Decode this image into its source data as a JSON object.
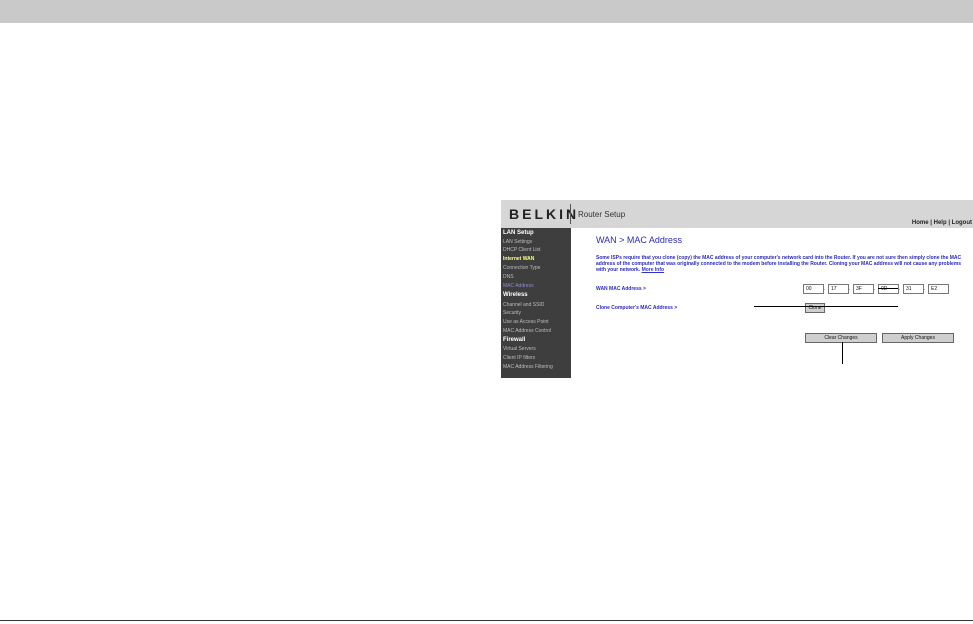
{
  "logo": "BELKIN",
  "app_title": "Router Setup",
  "header_links": [
    "Home",
    "Help",
    "Logout"
  ],
  "header_link_sep": "|",
  "sidebar": [
    {
      "label": "LAN Setup",
      "kind": "head"
    },
    {
      "label": "LAN Settings",
      "kind": "item"
    },
    {
      "label": "DHCP Client List",
      "kind": "item"
    },
    {
      "label": "Internet WAN",
      "kind": "active"
    },
    {
      "label": "Connection Type",
      "kind": "item"
    },
    {
      "label": "DNS",
      "kind": "item"
    },
    {
      "label": "MAC Address",
      "kind": "current"
    },
    {
      "label": "Wireless",
      "kind": "head"
    },
    {
      "label": "Channel and SSID",
      "kind": "item"
    },
    {
      "label": "Security",
      "kind": "item"
    },
    {
      "label": "Use as Access Point",
      "kind": "item"
    },
    {
      "label": "MAC Address Control",
      "kind": "item"
    },
    {
      "label": "Firewall",
      "kind": "head"
    },
    {
      "label": "Virtual Servers",
      "kind": "item"
    },
    {
      "label": "Client IP filters",
      "kind": "item"
    },
    {
      "label": "MAC Address Filtering",
      "kind": "item"
    }
  ],
  "main": {
    "title": "WAN > MAC Address",
    "description": "Some ISPs require that you clone (copy) the MAC address of your computer's network card into the Router. If you are not sure then simply clone the MAC address of the computer that was originally connected to the modem before installing the Router. Cloning your MAC address will not cause any problems with your network.",
    "more_info": "More Info",
    "wan_mac_label": "WAN MAC Address >",
    "mac_octets": [
      "00",
      "17",
      "3F",
      "0D",
      "31",
      "E2"
    ],
    "mac_separator": ".",
    "clone_label": "Clone Computer's MAC Address >",
    "clone_button": "Clone",
    "clear_button": "Clear Changes",
    "apply_button": "Apply Changes"
  }
}
